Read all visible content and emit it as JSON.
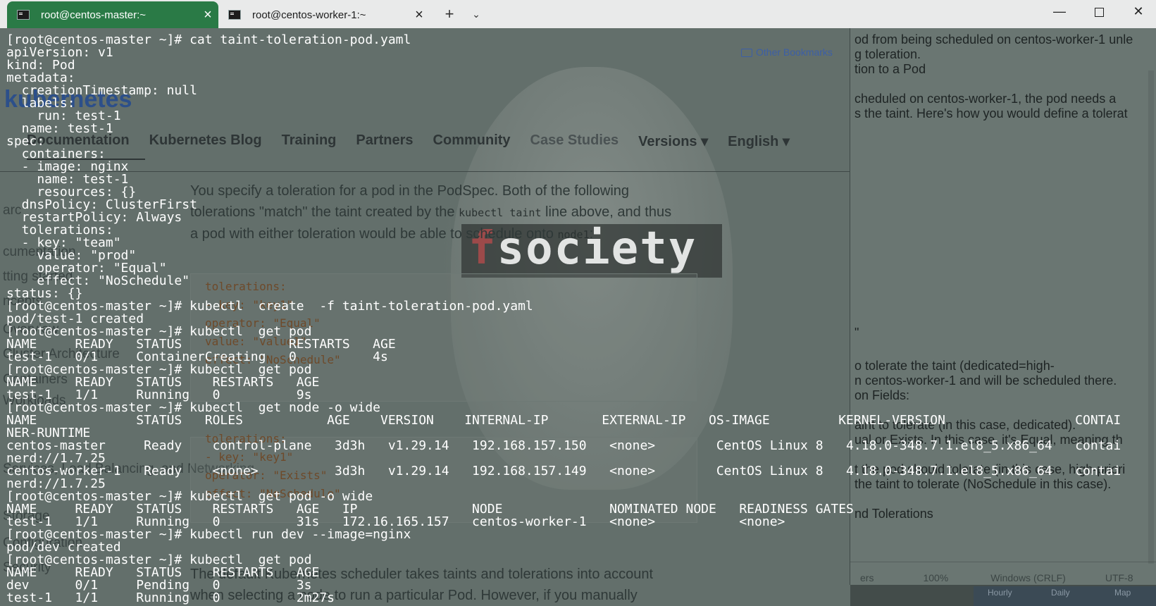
{
  "titlebar": {
    "tabs": [
      {
        "label": "root@centos-master:~",
        "active": true
      },
      {
        "label": "root@centos-worker-1:~",
        "active": false
      }
    ],
    "new_tab": "+",
    "dropdown": "⌄",
    "window_buttons": {
      "minimize": "—",
      "close": "✕"
    }
  },
  "background_browser": {
    "bookmarks": "Other Bookmarks",
    "logo": "kubernetes",
    "nav": [
      "Documentation",
      "Kubernetes Blog",
      "Training",
      "Partners",
      "Community",
      "Case Studies",
      "Versions ▾",
      "English ▾"
    ],
    "para_a": "You specify a toleration for a pod in the PodSpec. Both of the following tolerations \"match\" the taint created by the ",
    "code_a": "kubectl taint",
    "para_b": " line above, and thus a pod with either toleration would be able to schedule onto ",
    "code_b": "node1",
    "para_c": ":",
    "code_block_1": [
      "tolerations:",
      "- key: \"key1\"",
      "  operator: \"Equal\"",
      "  value: \"value1\"",
      "  effect: \"NoSchedule\""
    ],
    "code_block_2": [
      "tolerations:",
      "- key: \"key1\"",
      "  operator: \"Exists\"",
      "  effect: \"NoSchedule\""
    ],
    "para2": "The default Kubernetes scheduler takes taints and tolerations into account when selecting a node to run a particular Pod. However, if you manually",
    "side_items": [
      "arc",
      "cumentation",
      "tting started",
      "ncepts",
      "Overview",
      "Cluster Architecture",
      "Containers",
      "Workloads",
      "Services, Load Balancing, and Networking",
      "Storage",
      "Configuration",
      "Security"
    ],
    "overlay_text": "fsociety",
    "overlay_glyph": "f"
  },
  "notepad": {
    "lines": [
      "od from being scheduled on centos-worker-1 unle",
      "g toleration.",
      "tion to a Pod",
      "",
      "cheduled on centos-worker-1, the pod needs a",
      "s the taint. Here's how you would define a tolerat",
      "\"",
      "o tolerate the taint (dedicated=high-",
      "n centos-worker-1 and will be scheduled there.",
      "on Fields:",
      "aint to tolerate (in this case, dedicated).",
      "ual or Exists. In this case, it's Equal, meaning th",
      "t the pod should tolerate (in this case, high-priori",
      "the taint to tolerate (NoSchedule in this case).",
      "nd Tolerations"
    ],
    "status": {
      "encoding_left": "ers",
      "zoom": "100%",
      "line_ending": "Windows (CRLF)",
      "encoding": "UTF-8"
    },
    "bottom_pane": [
      "Hourly",
      "Daily",
      "Map"
    ]
  },
  "terminal": {
    "lines": [
      "[root@centos-master ~]# cat taint-toleration-pod.yaml",
      "apiVersion: v1",
      "kind: Pod",
      "metadata:",
      "  creationTimestamp: null",
      "  labels:",
      "    run: test-1",
      "  name: test-1",
      "spec:",
      "  containers:",
      "  - image: nginx",
      "    name: test-1",
      "    resources: {}",
      "  dnsPolicy: ClusterFirst",
      "  restartPolicy: Always",
      "  tolerations:",
      "  - key: \"team\"",
      "    value: \"prod\"",
      "    operator: \"Equal\"",
      "    effect: \"NoSchedule\"",
      "status: {}",
      "[root@centos-master ~]# kubectl  create  -f taint-toleration-pod.yaml",
      "pod/test-1 created",
      "[root@centos-master ~]# kubectl  get pod",
      "NAME     READY   STATUS              RESTARTS   AGE",
      "test-1   0/1     ContainerCreating   0          4s",
      "[root@centos-master ~]# kubectl  get pod",
      "NAME     READY   STATUS    RESTARTS   AGE",
      "test-1   1/1     Running   0          9s",
      "[root@centos-master ~]# kubectl  get node -o wide",
      "NAME             STATUS   ROLES           AGE    VERSION    INTERNAL-IP       EXTERNAL-IP   OS-IMAGE         KERNEL-VERSION                 CONTAI",
      "NER-RUNTIME",
      "centos-master     Ready    control-plane   3d3h   v1.29.14   192.168.157.150   <none>        CentOS Linux 8   4.18.0-348.7.1.el8_5.x86_64   contai",
      "nerd://1.7.25",
      "centos-worker-1   Ready    <none>          3d3h   v1.29.14   192.168.157.149   <none>        CentOS Linux 8   4.18.0-348.7.1.el8_5.x86_64   contai",
      "nerd://1.7.25",
      "[root@centos-master ~]# kubectl  get pod -o wide",
      "NAME     READY   STATUS    RESTARTS   AGE   IP               NODE              NOMINATED NODE   READINESS GATES",
      "test-1   1/1     Running   0          31s   172.16.165.157   centos-worker-1   <none>           <none>",
      "[root@centos-master ~]# kubectl run dev --image=nginx",
      "pod/dev created",
      "[root@centos-master ~]# kubectl  get pod",
      "NAME     READY   STATUS    RESTARTS   AGE",
      "dev      0/1     Pending   0          3s",
      "test-1   1/1     Running   0          2m27s"
    ]
  }
}
